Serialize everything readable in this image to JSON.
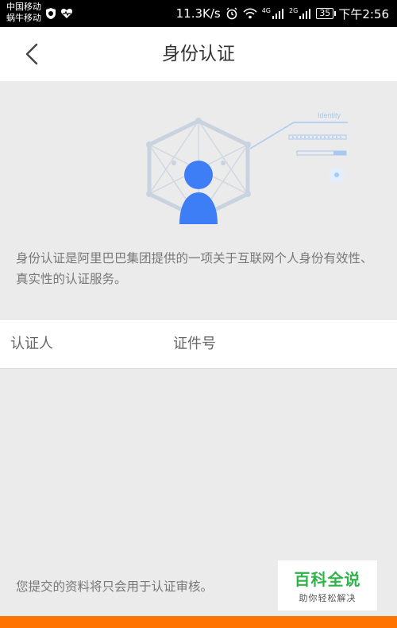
{
  "status_bar": {
    "carrier_1": "中国移动",
    "carrier_2": "蜗牛移动",
    "speed": "11.3K/s",
    "network_1": "4G",
    "network_2": "2G",
    "battery": "35",
    "time": "下午2:56"
  },
  "header": {
    "title": "身份认证",
    "back_icon": "chevron-left-icon"
  },
  "illustration": {
    "caption": "Identity",
    "accent": "#3d7df6"
  },
  "description": "身份认证是阿里巴巴集团提供的一项关于互联网个人身份有效性、真实性的认证服务。",
  "table": {
    "headers": [
      "认证人",
      "证件号"
    ]
  },
  "footnote": "您提交的资料将只会用于认证审核。",
  "watermark": {
    "main": "百科全说",
    "sub": "助你轻松解决"
  },
  "colors": {
    "accent_orange": "#ff7300",
    "brand_blue": "#3d7df6",
    "watermark_green": "#2fb44a"
  }
}
